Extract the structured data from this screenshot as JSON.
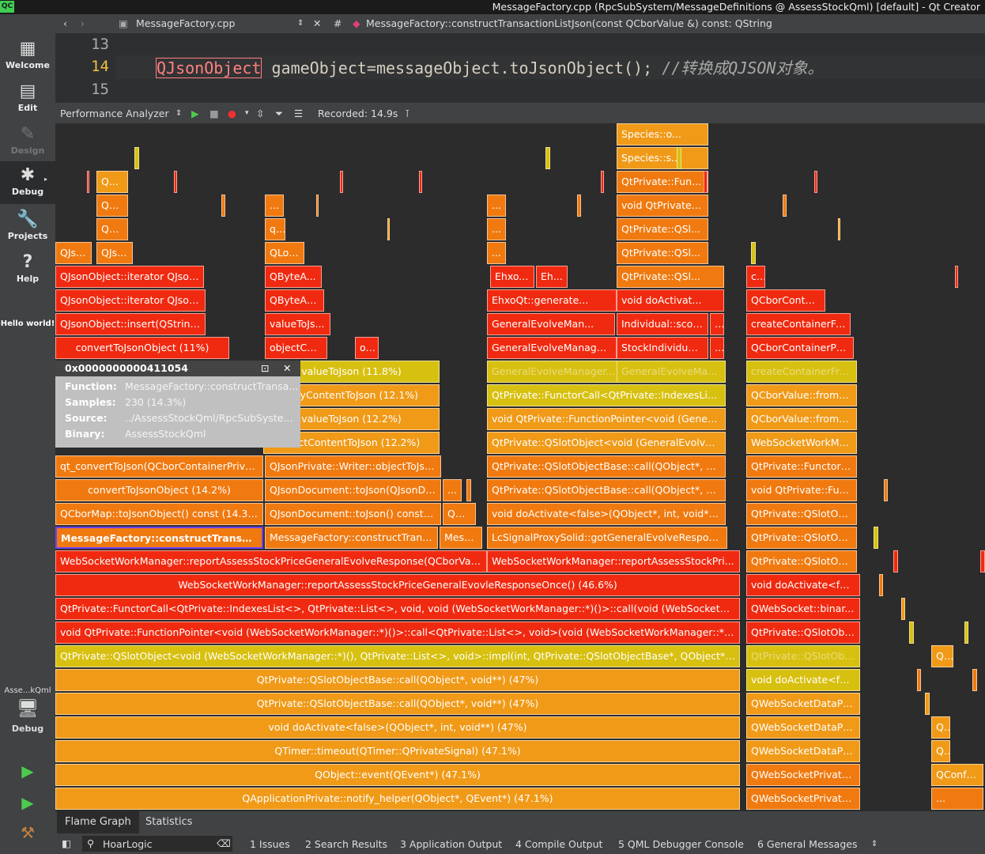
{
  "window": {
    "title": "MessageFactory.cpp (RpcSubSystem/MessageDefinitions @ AssessStockQml) [default] - Qt Creator",
    "qt_logo": "QC"
  },
  "modes": [
    {
      "label": "Welcome",
      "icon": "grid-icon"
    },
    {
      "label": "Edit",
      "icon": "edit-icon"
    },
    {
      "label": "Design",
      "icon": "pencil-icon"
    },
    {
      "label": "Debug",
      "icon": "bug-icon"
    },
    {
      "label": "Projects",
      "icon": "wrench-icon"
    },
    {
      "label": "Help",
      "icon": "help-icon"
    }
  ],
  "hello": "Hello world!",
  "kit": {
    "project": "Asse...kQml",
    "label": "Debug"
  },
  "editor": {
    "file": "MessageFactory.cpp",
    "hash": "#",
    "function": "MessageFactory::constructTransactionListJson(const QCborValue &) const: QString",
    "lines": [
      "13",
      "14",
      "15"
    ],
    "code_kw": "QJsonObject",
    "code_rest": " gameObject=messageObject.toJsonObject(); ",
    "code_comment": "//转换成QJSON对象。"
  },
  "toolbar": {
    "tool": "Performance Analyzer",
    "recorded": "Recorded: 14.9s"
  },
  "tooltip": {
    "address": "0x0000000000411054",
    "function_label": "Function:",
    "function": "MessageFactory::constructTransa...",
    "samples_label": "Samples:",
    "samples": "230 (14.3%)",
    "source_label": "Source:",
    "source": "../AssessStockQml/RpcSubSyste...",
    "binary_label": "Binary:",
    "binary": "AssessStockQml"
  },
  "tabs": [
    "Flame Graph",
    "Statistics"
  ],
  "statusbar": {
    "search": "HoarLogic",
    "panes": [
      "1 Issues",
      "2 Search Results",
      "3 Application Output",
      "4 Compile Output",
      "5 QML Debugger Console",
      "6 General Messages"
    ]
  },
  "colors": {
    "red": "#f02a10",
    "orange": "#f07a10",
    "amber": "#f09a18",
    "yellow": "#d8c010",
    "select": "#7040ff"
  },
  "flame": [
    {
      "label": "QApplicationPrivate::notify_helper(QObject*, QEvent*) (47.1%)",
      "color": "amber",
      "center": true
    },
    {
      "label": "QObject::event(QEvent*) (47.1%)",
      "color": "amber",
      "center": true
    },
    {
      "label": "QTimer::timeout(QTimer::QPrivateSignal) (47.1%)",
      "color": "amber",
      "center": true
    },
    {
      "label": "void doActivate<false>(QObject*, int, void**) (47%)",
      "color": "amber",
      "center": true
    },
    {
      "label": "QtPrivate::QSlotObjectBase::call(QObject*, void**) (47%)",
      "color": "amber",
      "center": true
    },
    {
      "label": "QtPrivate::QSlotObjectBase::call(QObject*, void**) (47%)",
      "color": "amber",
      "center": true
    },
    {
      "label": "QtPrivate::QSlotObject<void (WebSocketWorkManager::*)(), QtPrivate::List<>, void>::impl(int, QtPrivate::QSlotObjectBase*, QObject*, void...",
      "color": "yellow"
    },
    {
      "label": "void QtPrivate::FunctionPointer<void (WebSocketWorkManager::*)()>::call<QtPrivate::List<>, void>(void (WebSocketWorkManager::*)(), W...",
      "color": "red"
    },
    {
      "label": "QtPrivate::FunctorCall<QtPrivate::IndexesList<>, QtPrivate::List<>, void, void (WebSocketWorkManager::*)()>::call(void (WebSocketWorkM...",
      "color": "red"
    },
    {
      "label": "WebSocketWorkManager::reportAssessStockPriceGeneralEvovleResponseOnce() (46.6%)",
      "color": "red",
      "center": true
    },
    {
      "label": "WebSocketWorkManager::reportAssessStockPriceGeneralEvolveResponse(QCborValue ...",
      "color": "red"
    },
    {
      "label": "MessageFactory::constructTransact...",
      "color": "orange",
      "selected": true
    },
    {
      "label": "QCborMap::toJsonObject() const (14.3%)",
      "color": "orange",
      "center": true
    },
    {
      "label": "convertToJsonObject (14.2%)",
      "color": "orange",
      "center": true
    },
    {
      "label": "qt_convertToJson(QCborContainerPrivat...",
      "color": "orange"
    },
    {
      "label": "MessageFactory::constructTransa...",
      "color": "orange"
    },
    {
      "label": "Mess...",
      "color": "orange"
    },
    {
      "label": "QJsonDocument::toJson() const (...",
      "color": "orange"
    },
    {
      "label": "QSt...",
      "color": "orange"
    },
    {
      "label": "QJsonDocument::toJson(QJsonDo...",
      "color": "orange"
    },
    {
      "label": "...",
      "color": "orange"
    },
    {
      "label": "QJsonPrivate::Writer::objectToJso...",
      "color": "orange"
    },
    {
      "label": "...ectContentToJson (12.2%)",
      "color": "amber",
      "center": true
    },
    {
      "label": "valueToJson (12.2%)",
      "color": "amber",
      "center": true
    },
    {
      "label": "...ayContentToJson (12.1%)",
      "color": "amber",
      "center": true
    },
    {
      "label": "valueToJson (11.8%)",
      "color": "yellow",
      "center": true
    },
    {
      "label": "objectContent...",
      "color": "red"
    },
    {
      "label": "o...",
      "color": "red"
    },
    {
      "label": "valueToJs...",
      "color": "red"
    },
    {
      "label": "QByteArr...",
      "color": "red"
    },
    {
      "label": "QByteA...",
      "color": "red"
    },
    {
      "label": "QLocal...",
      "color": "orange"
    },
    {
      "label": "q...",
      "color": "orange"
    },
    {
      "label": "...",
      "color": "orange"
    },
    {
      "label": "convertToJsonObject (11%)",
      "color": "red",
      "center": true
    },
    {
      "label": "QJsonObject::insert(QStringV...",
      "color": "red"
    },
    {
      "label": "QJsonObject::iterator QJsonO...",
      "color": "red"
    },
    {
      "label": "QJsonObject::iterator QJson...",
      "color": "red"
    },
    {
      "label": "QJso...",
      "color": "orange"
    },
    {
      "label": "QJso...",
      "color": "orange"
    },
    {
      "label": "QC...",
      "color": "orange"
    },
    {
      "label": "QC...",
      "color": "orange"
    },
    {
      "label": "Q...",
      "color": "amber"
    },
    {
      "label": "LcSignalProxySolid::gotGeneralEvolveRespons...",
      "color": "orange"
    },
    {
      "label": "void doActivate<false>(QObject*, int, void**) (...",
      "color": "orange"
    },
    {
      "label": "QtPrivate::QSlotObjectBase::call(QObject*, voi...",
      "color": "orange"
    },
    {
      "label": "QtPrivate::QSlotObjectBase::call(QObject*, voi...",
      "color": "orange"
    },
    {
      "label": "QtPrivate::QSlotObject<void (GeneralEvolveM...",
      "color": "amber"
    },
    {
      "label": "void QtPrivate::FunctionPointer<void (General...",
      "color": "amber"
    },
    {
      "label": "QtPrivate::FunctorCall<QtPrivate::IndexesList<...",
      "color": "yellow"
    },
    {
      "label": "GeneralEvolveManager...",
      "color": "yellow",
      "fade": true
    },
    {
      "label": "GeneralEvolveMan...",
      "color": "yellow",
      "fade": true
    },
    {
      "label": "GeneralEvolveManager...",
      "color": "red"
    },
    {
      "label": "StockIndividual...",
      "color": "red"
    },
    {
      "label": "...",
      "color": "red"
    },
    {
      "label": "GeneralEvolveMan...",
      "color": "red"
    },
    {
      "label": "Individual::scor...",
      "color": "red"
    },
    {
      "label": "...",
      "color": "red"
    },
    {
      "label": "EhxoQt::generate...",
      "color": "red"
    },
    {
      "label": "void doActivat...",
      "color": "red"
    },
    {
      "label": "Ehxo...",
      "color": "red"
    },
    {
      "label": "Eh...",
      "color": "red"
    },
    {
      "label": "QtPrivate::QSl...",
      "color": "orange"
    },
    {
      "label": "QtPrivate::QSl...",
      "color": "orange"
    },
    {
      "label": "QtPrivate::QSl...",
      "color": "orange"
    },
    {
      "label": "void QtPrivate:...",
      "color": "orange"
    },
    {
      "label": "QtPrivate::Fun...",
      "color": "orange"
    },
    {
      "label": "Species::s...",
      "color": "amber"
    },
    {
      "label": "Species::o...",
      "color": "amber"
    },
    {
      "label": "...",
      "color": "orange"
    },
    {
      "label": "...",
      "color": "orange"
    },
    {
      "label": "...",
      "color": "orange"
    },
    {
      "label": "WebSocketWorkManager::reportAssessStockPri...",
      "color": "red"
    },
    {
      "label": "QWebSocketPrivate::...",
      "color": "orange"
    },
    {
      "label": "QWebSocketPrivate::...",
      "color": "orange"
    },
    {
      "label": "QWebSocketDataPro...",
      "color": "amber"
    },
    {
      "label": "QWebSocketDataPro...",
      "color": "amber"
    },
    {
      "label": "QWebSocketDataPro...",
      "color": "amber"
    },
    {
      "label": "void doActivate<fal...",
      "color": "yellow"
    },
    {
      "label": "QtPrivate::QSlotObj...",
      "color": "yellow",
      "fade": true
    },
    {
      "label": "QtPrivate::QSlotObj...",
      "color": "red"
    },
    {
      "label": "QWebSocket::binar...",
      "color": "red"
    },
    {
      "label": "void doActivate<fal...",
      "color": "red"
    },
    {
      "label": "QtPrivate::QSlotObj...",
      "color": "orange"
    },
    {
      "label": "QtPrivate::QSlotObj...",
      "color": "orange"
    },
    {
      "label": "QtPrivate::QSlotObj...",
      "color": "orange"
    },
    {
      "label": "void QtPrivate::Fun...",
      "color": "orange"
    },
    {
      "label": "QtPrivate::FunctorC...",
      "color": "orange"
    },
    {
      "label": "WebSocketWorkMa...",
      "color": "amber"
    },
    {
      "label": "QCborValue::fromC...",
      "color": "amber"
    },
    {
      "label": "QCborValue::fromC...",
      "color": "amber"
    },
    {
      "label": "createContainerFro...",
      "color": "yellow",
      "fade": true
    },
    {
      "label": "QCborContainerPri...",
      "color": "red"
    },
    {
      "label": "createContainerFr...",
      "color": "red"
    },
    {
      "label": "QCborContainerP...",
      "color": "red"
    },
    {
      "label": "createContai...",
      "color": "red"
    },
    {
      "label": "...",
      "color": "orange"
    },
    {
      "label": "QConfFil...",
      "color": "amber"
    },
    {
      "label": "QConfFil...",
      "color": "amber"
    },
    {
      "label": "Q...",
      "color": "amber"
    },
    {
      "label": "Q...",
      "color": "amber"
    },
    {
      "label": "...",
      "color": "red"
    }
  ]
}
